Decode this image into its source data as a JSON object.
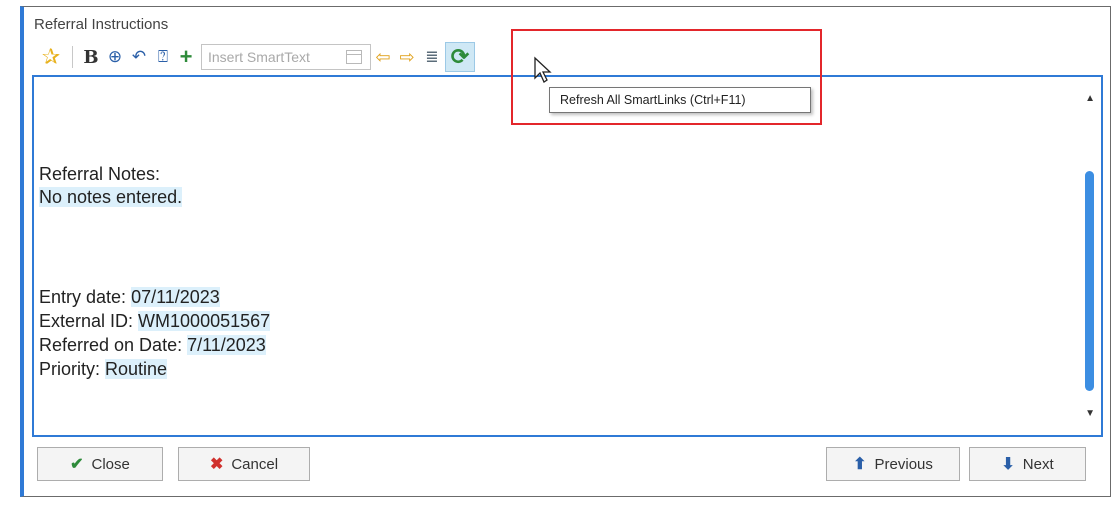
{
  "section": {
    "title": "Referral Instructions"
  },
  "toolbar": {
    "smarttext_placeholder": "Insert SmartText",
    "tooltip": "Refresh All SmartLinks (Ctrl+F11)",
    "icons": [
      "star-icon",
      "bold-icon",
      "zoom-icon",
      "undo-icon",
      "smartphrase-icon",
      "add-icon",
      "insert-smarttext-icon",
      "previous-field-icon",
      "next-field-icon",
      "list-icon",
      "refresh-icon"
    ]
  },
  "editor": {
    "referral_notes_label": "Referral Notes:",
    "referral_notes_value": "No notes entered. ",
    "entry_date_label": "Entry date: ",
    "entry_date_value": "07/11/2023",
    "external_id_label": "External ID: ",
    "external_id_value": "WM1000051567",
    "referred_on_label": "Referred on Date: ",
    "referred_on_value": "7/11/2023",
    "priority_label": "Priority: ",
    "priority_value": "Routine"
  },
  "buttons": {
    "close": "Close",
    "cancel": "Cancel",
    "previous": "Previous",
    "next": "Next"
  },
  "colors": {
    "accent": "#2f7ad6",
    "highlight_box": "#e3262b",
    "smartlink_bg": "#dcf0fb"
  }
}
